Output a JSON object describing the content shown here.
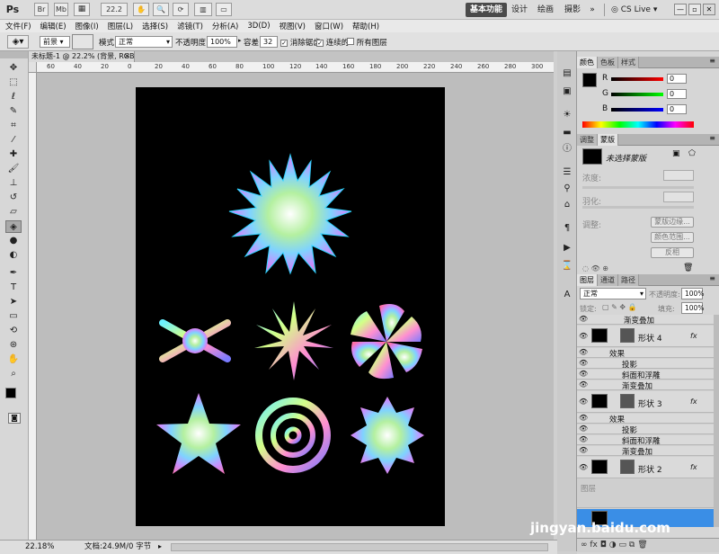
{
  "app": {
    "logo": "Ps",
    "br_label": "Br",
    "mb_label": "Mb",
    "zoom_value": "22.2",
    "workspaces": [
      "基本功能",
      "设计",
      "绘画",
      "摄影"
    ],
    "more_label": "»",
    "cslive_label": "CS Live",
    "window_buttons": [
      "—",
      "▫",
      "✕"
    ]
  },
  "menu": [
    "文件(F)",
    "编辑(E)",
    "图像(I)",
    "图层(L)",
    "选择(S)",
    "滤镜(T)",
    "分析(A)",
    "3D(D)",
    "视图(V)",
    "窗口(W)",
    "帮助(H)"
  ],
  "options": {
    "fill_source": "前景",
    "mode_label": "模式:",
    "mode_value": "正常",
    "opacity_label": "不透明度:",
    "opacity_value": "100%",
    "tolerance_label": "容差:",
    "tolerance_value": "32",
    "antialias_label": "消除锯齿",
    "contiguous_label": "连续的",
    "alllayers_label": "所有图层"
  },
  "document": {
    "tab_title": "未标题-1 @ 22.2% (背景, RGB/8) *",
    "ruler_top_ticks": [
      "60",
      "40",
      "20",
      "0",
      "20",
      "40",
      "60",
      "80",
      "100",
      "120",
      "140",
      "160",
      "180",
      "200",
      "220",
      "240",
      "260",
      "280",
      "300"
    ]
  },
  "status": {
    "zoom": "22.18%",
    "doc_info": "文档:24.9M/0 字节"
  },
  "color_panel": {
    "tabs": [
      "颜色",
      "色板",
      "样式"
    ],
    "channels": [
      {
        "label": "R",
        "value": "0"
      },
      {
        "label": "G",
        "value": "0"
      },
      {
        "label": "B",
        "value": "0"
      }
    ]
  },
  "adjust_panel": {
    "tabs": [
      "调整",
      "蒙版"
    ],
    "no_selection": "未选择蒙版",
    "density_label": "浓度:",
    "feather_label": "羽化:",
    "refine_label": "调整:",
    "buttons": [
      "蒙版边缘...",
      "颜色范围...",
      "反相"
    ]
  },
  "layers_panel": {
    "tabs": [
      "图层",
      "通道",
      "路径"
    ],
    "blend_mode": "正常",
    "opacity_label": "不透明度:",
    "opacity_value": "100%",
    "lock_label": "锁定:",
    "fill_label": "填充:",
    "fill_value": "100%",
    "top_effect": "渐变叠加",
    "layers": [
      {
        "name": "形状 4",
        "effects_label": "效果",
        "effects": [
          "投影",
          "斜面和浮雕",
          "渐变叠加"
        ]
      },
      {
        "name": "形状 3",
        "effects_label": "效果",
        "effects": [
          "投影",
          "斜面和浮雕",
          "渐变叠加"
        ]
      },
      {
        "name": "形状 2"
      }
    ],
    "fx_label": "fx",
    "bottom_partial": "图层"
  },
  "watermark": "jingyan.baidu.com",
  "icons": {
    "tools": [
      "move-icon",
      "marquee-icon",
      "lasso-icon",
      "quick-select-icon",
      "crop-icon",
      "eyedropper-icon",
      "healing-icon",
      "brush-icon",
      "clone-stamp-icon",
      "history-brush-icon",
      "eraser-icon",
      "paint-bucket-icon",
      "blur-icon",
      "dodge-icon",
      "pen-icon",
      "type-icon",
      "path-select-icon",
      "shape-icon",
      "3d-rotate-icon",
      "3d-orbit-icon",
      "hand-icon",
      "zoom-icon"
    ]
  },
  "colors": {
    "foreground": "#000000",
    "background": "#ffffff",
    "accent": "#4b4b4b"
  }
}
